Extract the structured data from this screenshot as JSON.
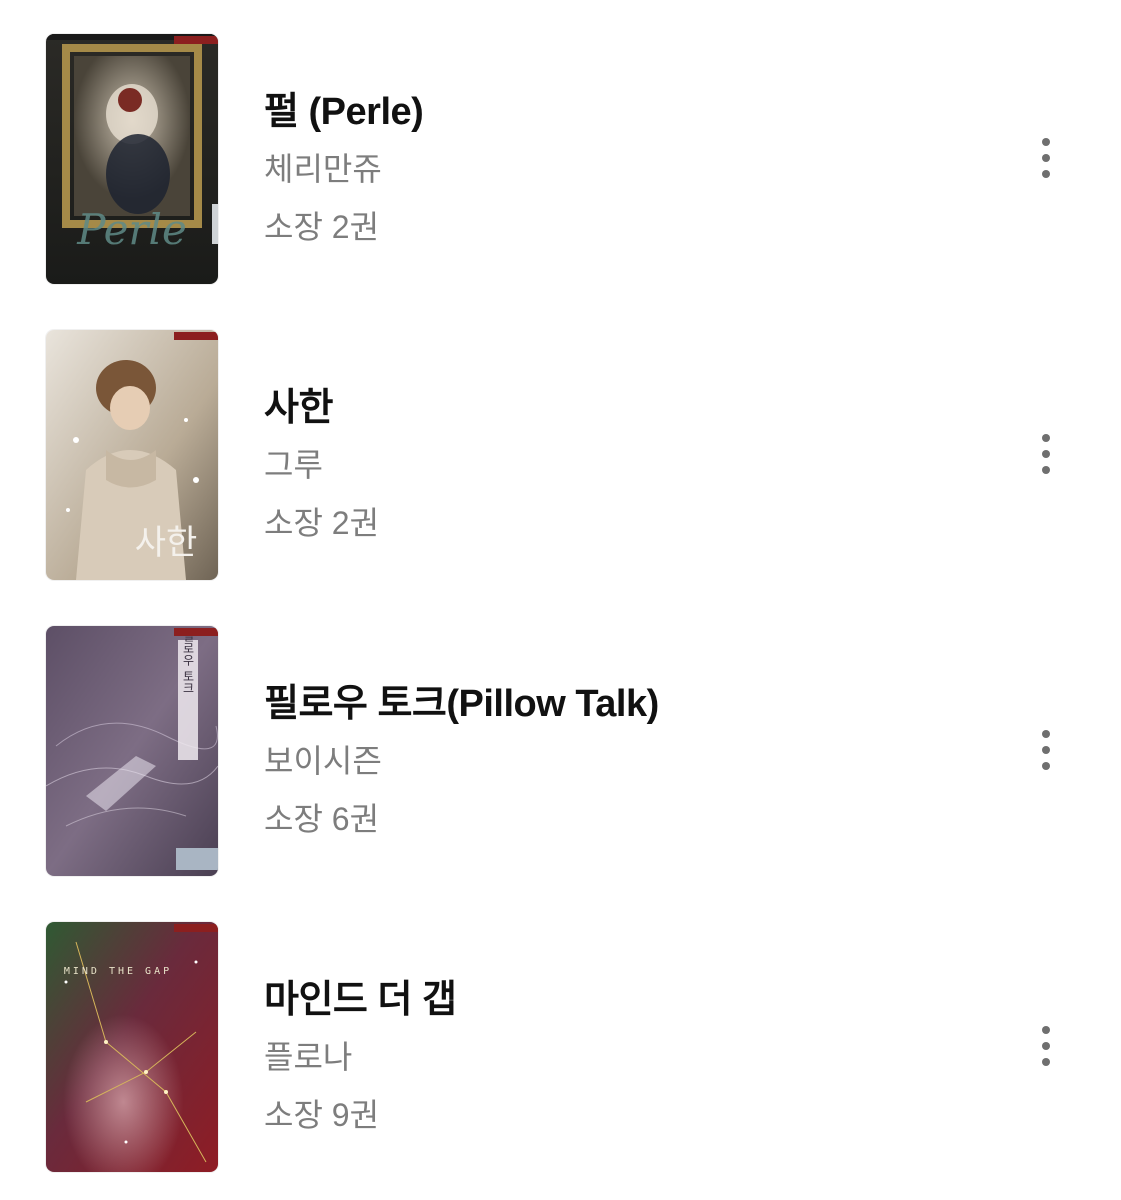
{
  "books": [
    {
      "title": "펄 (Perle)",
      "author": "체리만쥬",
      "owned": "소장 2권",
      "cover_art_text": "Perle"
    },
    {
      "title": "사한",
      "author": "그루",
      "owned": "소장 2권",
      "cover_art_text": "사한"
    },
    {
      "title": "필로우 토크(Pillow Talk)",
      "author": "보이시즌",
      "owned": "소장 6권",
      "cover_art_text": "필로우 토크"
    },
    {
      "title": "마인드 더 갭",
      "author": "플로나",
      "owned": "소장 9권",
      "cover_art_text": "MIND THE GAP"
    }
  ],
  "icons": {
    "more": "more-vertical-icon"
  },
  "colors": {
    "title": "#111111",
    "meta": "#7d7d7d",
    "menu_dots": "#6f6f6f"
  }
}
